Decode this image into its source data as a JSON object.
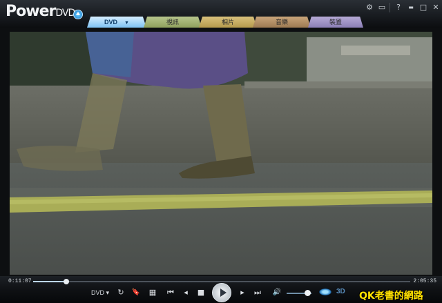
{
  "app": {
    "logo_main": "Power",
    "logo_sub": "DVD"
  },
  "window_controls": {
    "settings_icon": "gear-icon",
    "tv_icon": "tv-icon",
    "help": "?",
    "minimize": "▬",
    "maximize": "□",
    "close": "✕"
  },
  "tabs": [
    {
      "label": "DVD",
      "active": true
    },
    {
      "label": "視訊",
      "active": false
    },
    {
      "label": "相片",
      "active": false
    },
    {
      "label": "音樂",
      "active": false
    },
    {
      "label": "裝置",
      "active": false
    }
  ],
  "tab_caret": "▼",
  "playback": {
    "elapsed": "0:11:07",
    "total": "2:05:35",
    "progress_fraction": 0.088,
    "volume_fraction": 0.8
  },
  "controls": {
    "dvd_menu": "DVD ▾",
    "repeat": "↻",
    "bookmark": "🔖",
    "grid": "▦",
    "prev_chapter": "⏮",
    "step_back": "◂",
    "stop": "■",
    "step_forward": "▸",
    "next_chapter": "⏭",
    "volume_icon": "🔊"
  },
  "label_3d": "3D",
  "watermark": "QK老書的網路"
}
